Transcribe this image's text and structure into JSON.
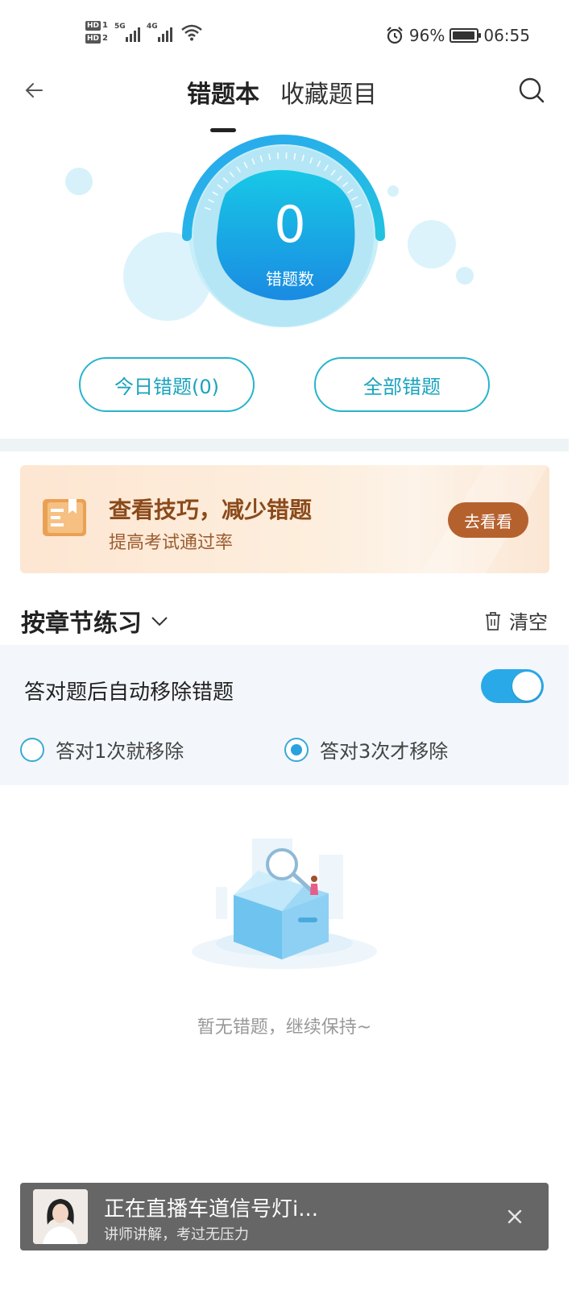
{
  "status_bar": {
    "hd1": "HD",
    "hd1_sub": "1",
    "hd2": "HD",
    "hd2_sub": "2",
    "net1": "5G",
    "net2": "4G",
    "battery_text": "96%",
    "battery_level": 0.96,
    "time": "06:55",
    "icons": [
      "signal-icon",
      "wifi-icon",
      "alarm-icon",
      "battery-icon"
    ]
  },
  "header": {
    "tabs": [
      {
        "label": "错题本",
        "active": true
      },
      {
        "label": "收藏题目",
        "active": false
      }
    ],
    "back_icon": "back-arrow-icon",
    "search_icon": "search-icon"
  },
  "gauge": {
    "count": "0",
    "label": "错题数"
  },
  "filters": {
    "today": "今日错题(0)",
    "all": "全部错题"
  },
  "banner": {
    "title": "查看技巧，减少错题",
    "subtitle": "提高考试通过率",
    "button": "去看看",
    "icon": "book-icon"
  },
  "section": {
    "title": "按章节练习",
    "clear": "清空"
  },
  "settings": {
    "auto_remove_label": "答对题后自动移除错题",
    "auto_remove_on": true,
    "options": [
      {
        "label": "答对1次就移除",
        "checked": false
      },
      {
        "label": "答对3次才移除",
        "checked": true
      }
    ]
  },
  "empty": {
    "text": "暂无错题，继续保持~"
  },
  "live": {
    "title": "正在直播车道信号灯i...",
    "subtitle": "讲师讲解，考过无压力"
  },
  "colors": {
    "accent": "#27b4cd",
    "toggle": "#2aa9e8",
    "banner_button": "#b5612e",
    "banner_title": "#8a4a1a"
  }
}
